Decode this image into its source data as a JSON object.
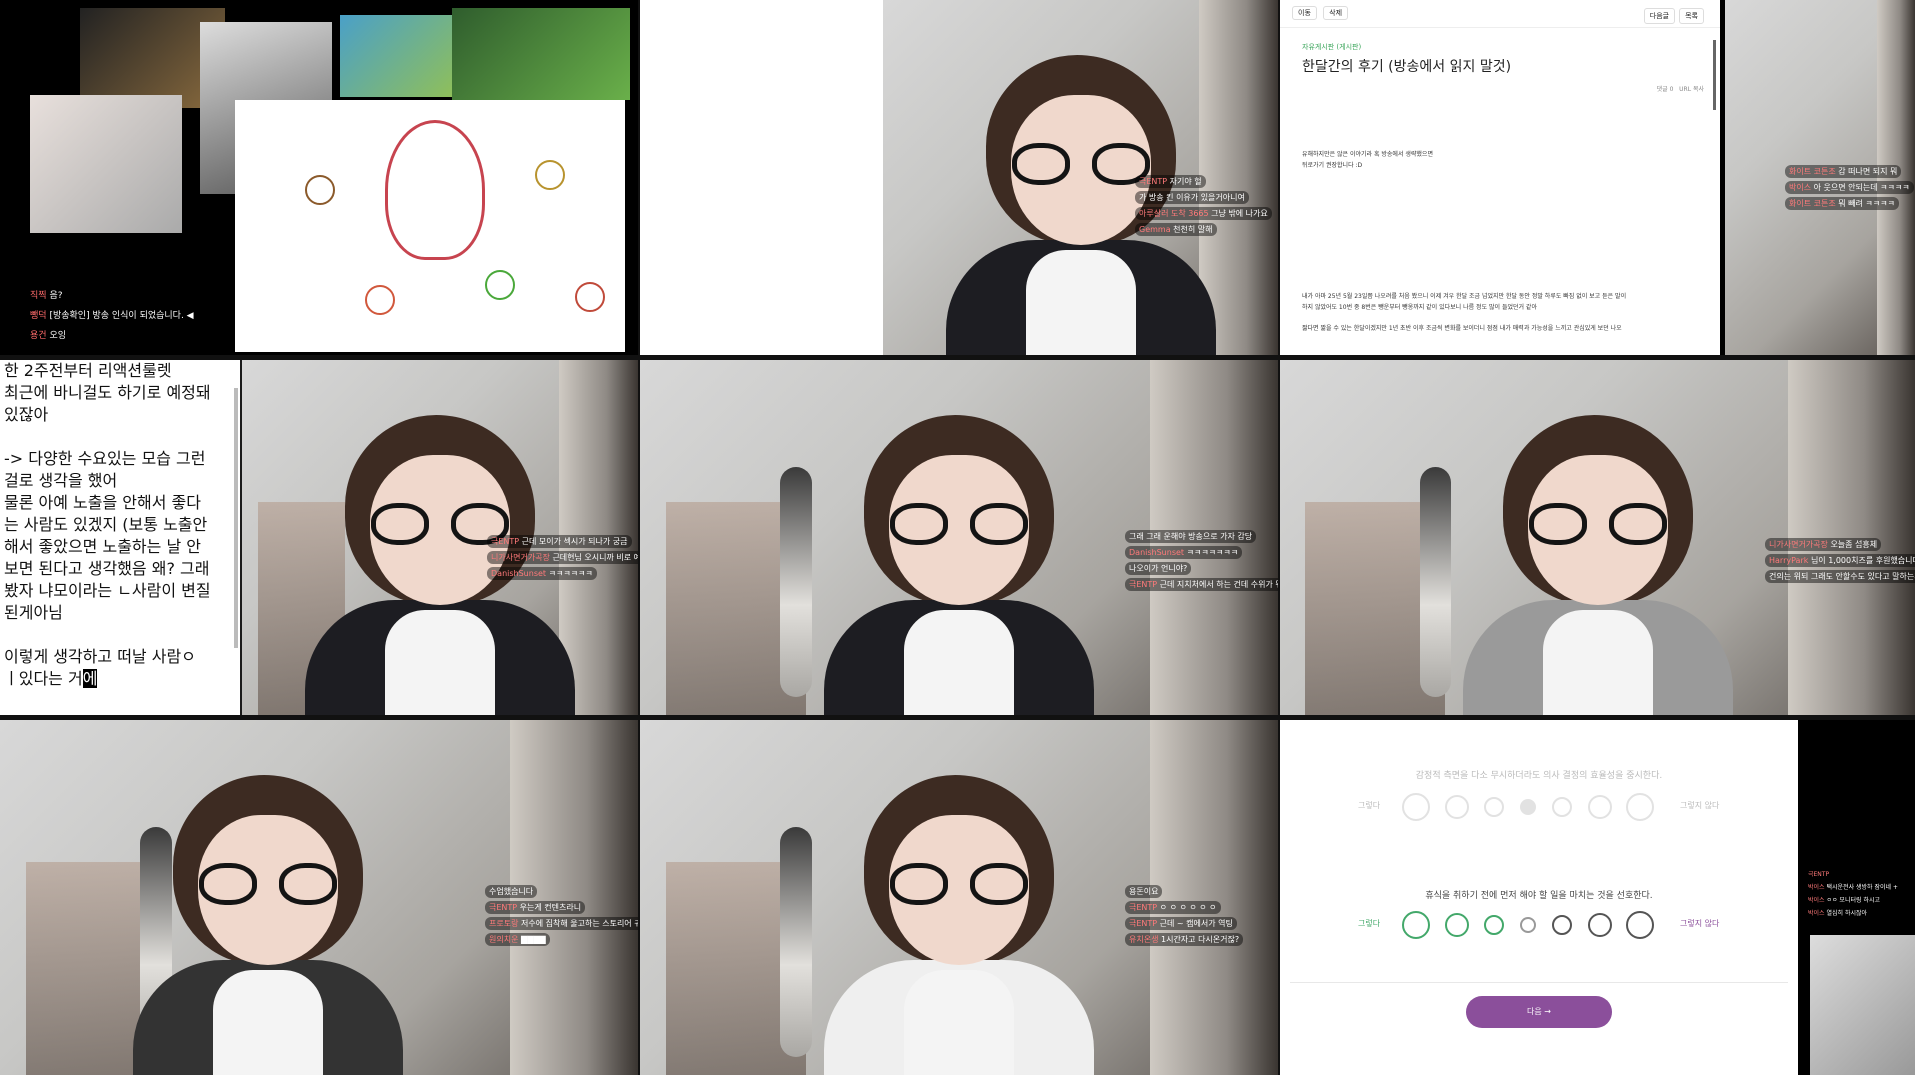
{
  "cell1": {
    "chat": [
      {
        "user": "직찍",
        "msg": "음?"
      },
      {
        "user": "뺑덕",
        "msg": "[방송확인] 방송 인식이 되었습니다. ◀"
      },
      {
        "user": "용건",
        "msg": "오잉"
      }
    ]
  },
  "cell2": {
    "chat": [
      {
        "user": "극ENTP",
        "msg": "자기야 헐"
      },
      {
        "user": "",
        "msg": "가 방송 킨 이유가 있을거아니여"
      },
      {
        "user": "아루살러 도착 3665",
        "msg": "그냥 밖에 나가요"
      },
      {
        "user": "Gemma",
        "msg": "천천히 말해"
      }
    ]
  },
  "cell3": {
    "buttons": [
      "이동",
      "삭제"
    ],
    "right_buttons": [
      "다음글",
      "목록"
    ],
    "crumb": "자유게시판 (게시판)",
    "title": "한달간의 후기 (방송에서 읽지 말것)",
    "comment_label": "댓글 0",
    "url_copy": "URL 복사",
    "para1": "유해하지만은 않은 이야기라 혹 방송에서 생략했으면",
    "para2": "뒤로가기 권장합니다 :D",
    "para3": "내가 아마 25년 5월 23일쯤 나오려를 처음 봤으니 이제 겨우 한달 조금 넘었지만 한달 동안 정말 하루도 빠짐 없이 보고 듣은 말이",
    "para4": "하지 않았어도 10번 중 8번은 뺑운부터 뺑옹까지 같이 있다보니 나름 정도 많이 들었던거 같아",
    "para5": "짧다면 짧을 수 있는 한달이겠지만 1년 초반 이후 조금씩 변화를 보이더니 점점 내가 매력과 가능성을 느끼고 관심있게 보던 나오",
    "chat": [
      {
        "user": "",
        "msg": ""
      },
      {
        "user": "화이트 코튼조",
        "msg": "감 떠나면 되지 뭐"
      },
      {
        "user": "박이스",
        "msg": "아 웃으면 안되는데 ㅋㅋㅋㅋ"
      },
      {
        "user": "화이트 코튼조",
        "msg": "뭐 빼려 ㅋㅋㅋㅋ"
      }
    ]
  },
  "cell4": {
    "notes": "한 2주전부터 리액션룰렛\n최근에 바니걸도 하기로 예정돼\n있잖아\n\n-> 다양한 수요있는 모습 그런\n걸로 생각을 했어\n물론 아예 노출을 안해서 좋다\n는 사람도 있겠지 (보통 노출안\n해서 좋았으면 노출하는 날 안\n보면 된다고 생각했음 왜? 그래\n봤자 냐모이라는 ㄴ사람이 변질\n된게아님\n\n이렇게 생각하고 떠날 사람ㅇ\nㅣ있다는 거",
    "cursor": "에",
    "chat": [
      {
        "user": "극ENTP",
        "msg": "근데 모이가 섹시가 되나가 궁금"
      },
      {
        "user": "니가사면거가곡장",
        "msg": "근데현님 오시니까 비로 예는 좋보하는거해"
      },
      {
        "user": "DanishSunset",
        "msg": "ㅋㅋㅋㅋㅋㅋ"
      }
    ]
  },
  "cell5": {
    "chat": [
      {
        "user": "",
        "msg": "그래 그래 운해야 방송으로 가자 감당"
      },
      {
        "user": "DanishSunset",
        "msg": "ㅋㅋㅋㅋㅋㅋㅋ"
      },
      {
        "user": "",
        "msg": "나오이가 언니야?"
      },
      {
        "user": "극ENTP",
        "msg": "근데 지치처에서 하는 건데 수위가 뭐 없다 되다고"
      }
    ]
  },
  "cell6": {
    "chat": [
      {
        "user": "",
        "msg": ""
      },
      {
        "user": "니가사면거가곡장",
        "msg": "오늘좀 섭흥체"
      },
      {
        "user": "HarryPark",
        "msg": "님이 1,000치즈를 후원했습니다"
      },
      {
        "user": "",
        "msg": "건의는 위되 그래도 안할수도 있다고 말하는게 좋아요"
      }
    ]
  },
  "cell7": {
    "chat": [
      {
        "user": "",
        "msg": "수업했습니다"
      },
      {
        "user": "극ENTP",
        "msg": "우는게 컨텐츠라니"
      },
      {
        "user": "프로토랑",
        "msg": "저수에 집착해 울고하는 스토리어 귀하거든요"
      },
      {
        "user": "원의치운",
        "msg": "▇▇▇▇"
      }
    ]
  },
  "cell8": {
    "chat": [
      {
        "user": "",
        "msg": "용돈이요"
      },
      {
        "user": "극ENTP",
        "msg": "ㅇ ㅇ ㅇ ㅇ ㅇ ㅇ"
      },
      {
        "user": "극ENTP",
        "msg": "근데 ~ 캠에서가 역팅"
      },
      {
        "user": "유치온생",
        "msg": "1시간자고 다시온거잖?"
      }
    ]
  },
  "cell9": {
    "q1": "감정적 측면을 다소 무시하더라도 의사 결정의 효율성을 중시한다.",
    "q2": "휴식을 취하기 전에 먼저 해야 할 일을 마치는 것을 선호한다.",
    "agree": "그렇다",
    "disagree": "그렇지 않다",
    "next": "다음 →",
    "side_chat": [
      {
        "user": "극ENTP",
        "msg": ""
      },
      {
        "user": "박이스",
        "msg": "택시운전사 생방하 잠이네 +"
      },
      {
        "user": "박이스",
        "msg": "ㅇㅇ 모니터링 하시고"
      },
      {
        "user": "박이스",
        "msg": "열심히 하시잖아"
      }
    ]
  }
}
